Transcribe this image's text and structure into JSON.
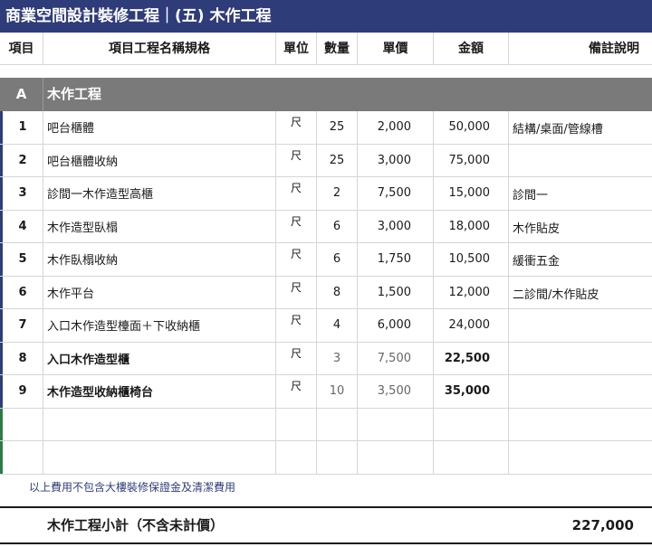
{
  "title": "商業空間設計裝修工程｜(五) 木作工程",
  "columns": {
    "no": "項目",
    "name": "項目工程名稱規格",
    "unit": "單位",
    "qty": "數量",
    "price": "單價",
    "amount": "金額",
    "note": "備註說明"
  },
  "section": {
    "letter": "A",
    "title": "木作工程"
  },
  "rows": [
    {
      "no": "1",
      "name": "吧台櫃體",
      "unit": "尺",
      "qty": "25",
      "price": "2,000",
      "amount": "50,000",
      "note": "結構/桌面/管線槽"
    },
    {
      "no": "2",
      "name": "吧台櫃體收納",
      "unit": "尺",
      "qty": "25",
      "price": "3,000",
      "amount": "75,000",
      "note": ""
    },
    {
      "no": "3",
      "name": "診間一木作造型高櫃",
      "unit": "尺",
      "qty": "2",
      "price": "7,500",
      "amount": "15,000",
      "note": "診間一"
    },
    {
      "no": "4",
      "name": "木作造型臥榻",
      "unit": "尺",
      "qty": "6",
      "price": "3,000",
      "amount": "18,000",
      "note": "木作貼皮"
    },
    {
      "no": "5",
      "name": "木作臥榻收納",
      "unit": "尺",
      "qty": "6",
      "price": "1,750",
      "amount": "10,500",
      "note": "緩衝五金"
    },
    {
      "no": "6",
      "name": "木作平台",
      "unit": "尺",
      "qty": "8",
      "price": "1,500",
      "amount": "12,000",
      "note": "二診間/木作貼皮"
    },
    {
      "no": "7",
      "name": "入口木作造型檯面＋下收納櫃",
      "unit": "尺",
      "qty": "4",
      "price": "6,000",
      "amount": "24,000",
      "note": ""
    },
    {
      "no": "8",
      "name": "入口木作造型櫃",
      "unit": "尺",
      "qty": "3",
      "price": "7,500",
      "amount": "22,500",
      "note": ""
    },
    {
      "no": "9",
      "name": "木作造型收納櫃椅台",
      "unit": "尺",
      "qty": "10",
      "price": "3,500",
      "amount": "35,000",
      "note": ""
    }
  ],
  "footnote": "以上費用不包含大樓裝修保證金及清潔費用",
  "subtotal": {
    "label": "木作工程小計（不含未計價）",
    "value": "227,000"
  }
}
